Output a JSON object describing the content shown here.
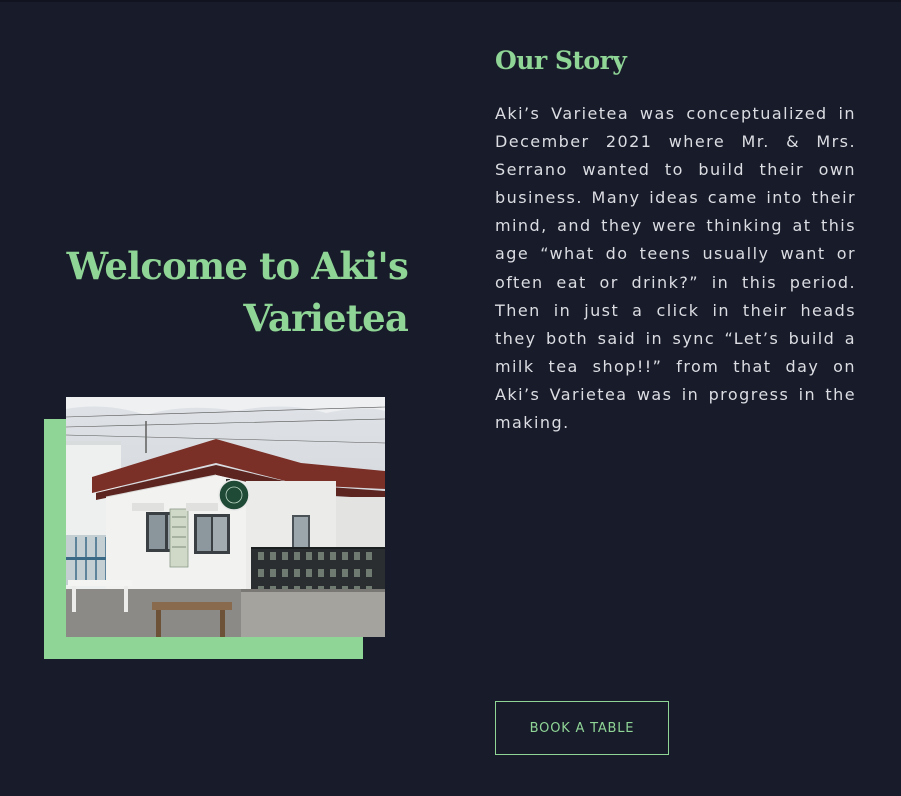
{
  "hero": {
    "title": "Welcome to Aki's Varietea",
    "photo_alt": "Aki's Varietea shop storefront"
  },
  "story": {
    "heading": "Our Story",
    "body": "Aki’s Varietea was conceptualized in December 2021 where Mr. & Mrs. Serrano wanted to build their own business. Many ideas came into their mind, and they were thinking at this age “what do teens usually want or often eat or drink?” in this period. Then in just a click in their heads they both said in sync “Let’s build a milk tea shop!!” from that day on Aki’s Varietea was in progress in the making."
  },
  "actions": {
    "book_label": "BOOK A TABLE"
  },
  "colors": {
    "background": "#181c2a",
    "accent": "#8fd596",
    "text": "#dcdde3"
  }
}
